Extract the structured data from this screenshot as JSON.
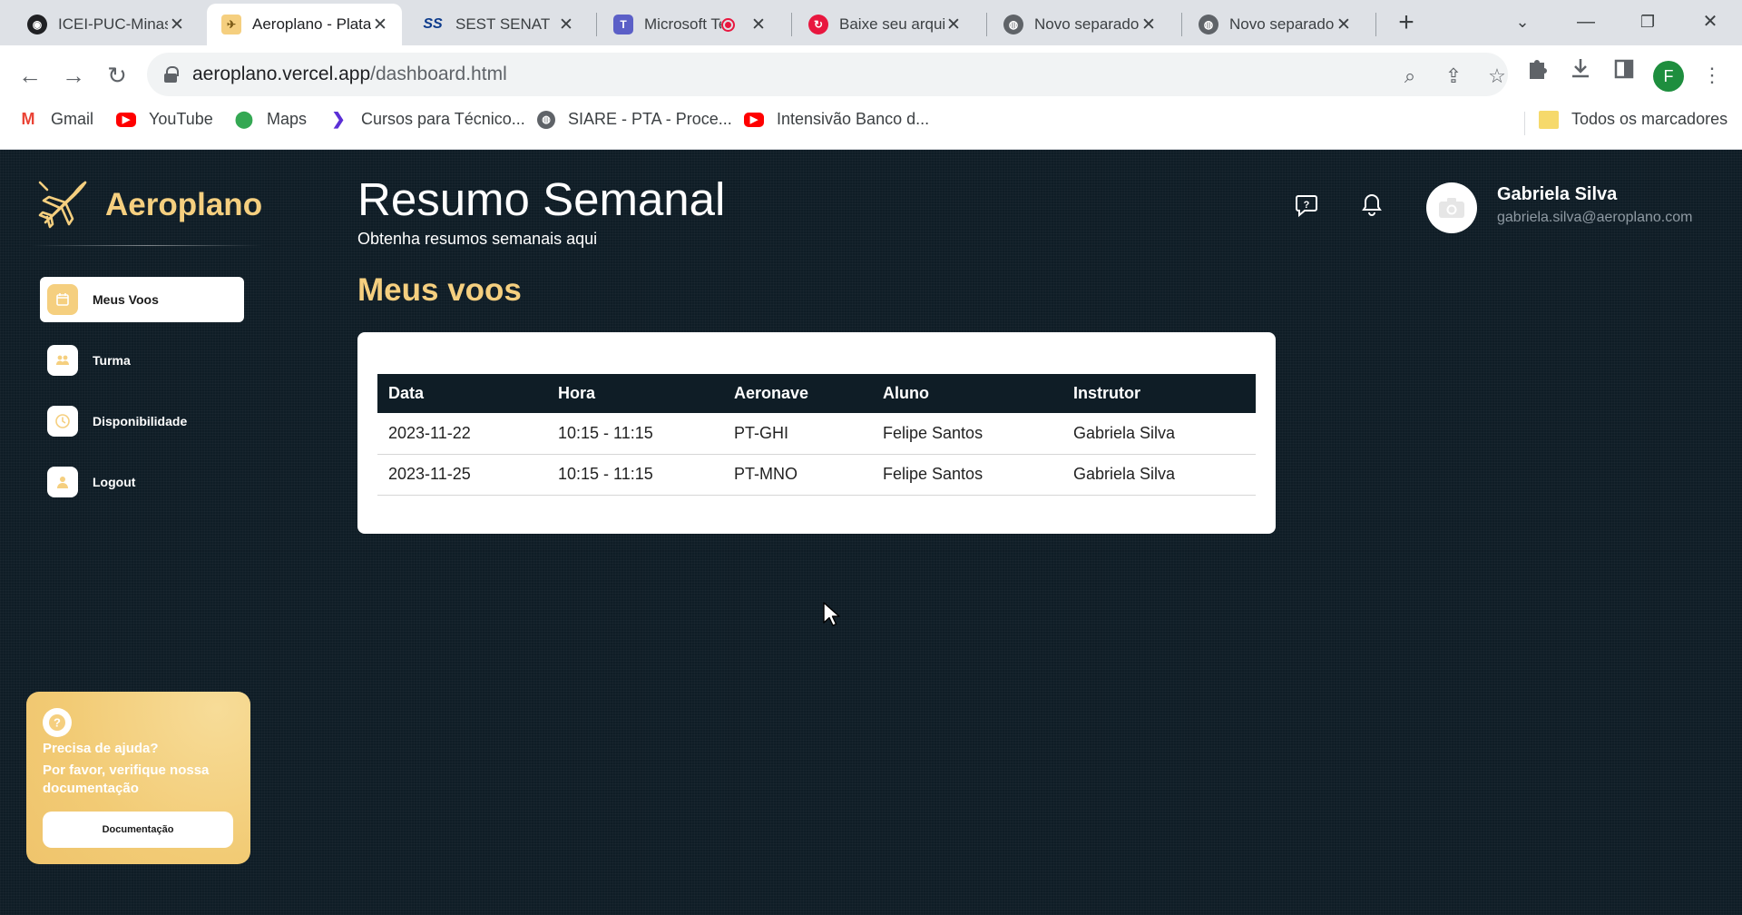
{
  "browser": {
    "tabs": [
      {
        "label": "ICEI-PUC-Minas",
        "fav_color": "#202124",
        "icon": "github-icon"
      },
      {
        "label": "Aeroplano - Plataforma",
        "fav_color": "#f5cf7f",
        "icon": "aeroplano-favicon"
      },
      {
        "label": "SEST SENAT",
        "fav_color": "#0d3b8c",
        "icon": "sest-senat-icon"
      },
      {
        "label": "Microsoft Teams",
        "fav_color": "#5b5fc7",
        "icon": "teams-icon"
      },
      {
        "label": "Baixe seu arquivo",
        "fav_color": "#e8173f",
        "icon": "download-site-icon"
      },
      {
        "label": "Novo separador",
        "fav_color": "#5f6368",
        "icon": "globe-icon"
      },
      {
        "label": "Novo separador",
        "fav_color": "#5f6368",
        "icon": "globe-icon"
      }
    ],
    "url_host": "aeroplano.vercel.app",
    "url_path": "/dashboard.html",
    "profile_initial": "F",
    "bookmarks": [
      {
        "label": "Gmail",
        "icon": "gmail-icon",
        "color": "#ea4335"
      },
      {
        "label": "YouTube",
        "icon": "youtube-icon",
        "color": "#ff0000"
      },
      {
        "label": "Maps",
        "icon": "maps-icon",
        "color": "#34a853"
      },
      {
        "label": "Cursos para Técnico...",
        "icon": "cursos-icon",
        "color": "#5b2fd6"
      },
      {
        "label": "SIARE - PTA - Proce...",
        "icon": "globe-icon",
        "color": "#5f6368"
      },
      {
        "label": "Intensivão Banco d...",
        "icon": "youtube-icon",
        "color": "#ff0000"
      }
    ],
    "all_bookmarks": "Todos os marcadores"
  },
  "app": {
    "brand": "Aeroplano",
    "nav": [
      {
        "label": "Meus Voos",
        "icon": "calendar-icon",
        "active": true
      },
      {
        "label": "Turma",
        "icon": "group-icon",
        "active": false
      },
      {
        "label": "Disponibilidade",
        "icon": "clock-icon",
        "active": false
      },
      {
        "label": "Logout",
        "icon": "user-icon",
        "active": false
      }
    ],
    "help": {
      "title": "Precisa de ajuda?",
      "text": "Por favor, verifique nossa documentação",
      "button": "Documentação"
    },
    "page_title": "Resumo Semanal",
    "page_subtitle": "Obtenha resumos semanais aqui",
    "section_title": "Meus voos",
    "user": {
      "name": "Gabriela Silva",
      "email": "gabriela.silva@aeroplano.com"
    },
    "accent": "#f5cf7f",
    "table": {
      "headers": [
        "Data",
        "Hora",
        "Aeronave",
        "Aluno",
        "Instrutor"
      ],
      "rows": [
        [
          "2023-11-22",
          "10:15 - 11:15",
          "PT-GHI",
          "Felipe Santos",
          "Gabriela Silva"
        ],
        [
          "2023-11-25",
          "10:15 - 11:15",
          "PT-MNO",
          "Felipe Santos",
          "Gabriela Silva"
        ]
      ]
    }
  }
}
